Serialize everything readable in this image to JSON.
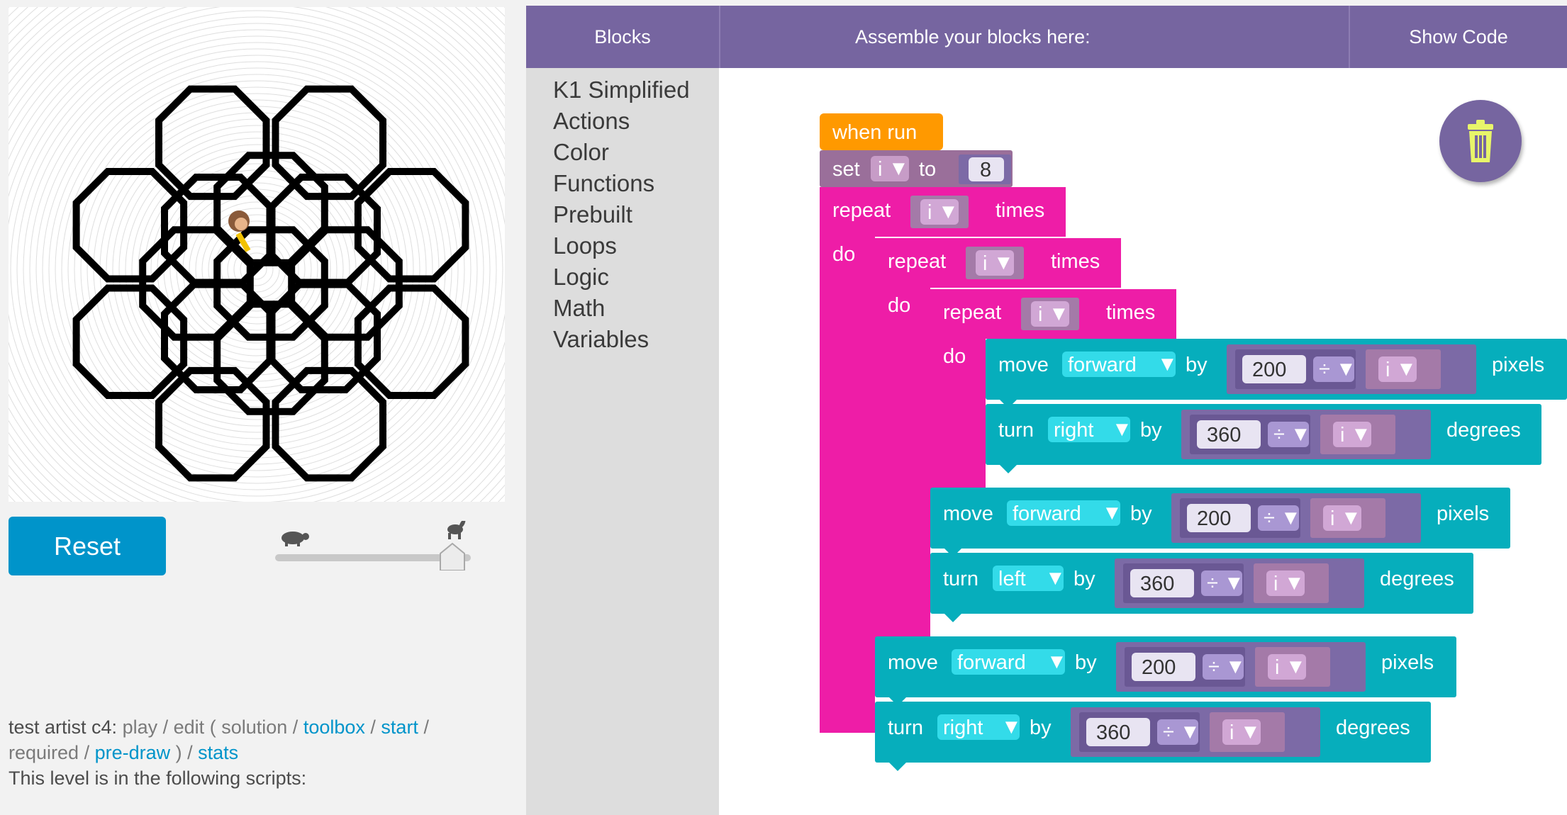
{
  "header": {
    "blocks_label": "Blocks",
    "workspace_label": "Assemble your blocks here:",
    "show_code_label": "Show Code"
  },
  "toolbox": {
    "categories": [
      "K1 Simplified",
      "Actions",
      "Color",
      "Functions",
      "Prebuilt",
      "Loops",
      "Logic",
      "Math",
      "Variables"
    ]
  },
  "controls": {
    "reset_label": "Reset",
    "speed_slider_value": 1.0
  },
  "level_info": {
    "name": "test artist c4:",
    "play": "play",
    "edit": "edit",
    "solution": "solution",
    "toolbox": "toolbox",
    "start": "start",
    "required": "required",
    "predraw": "pre-draw",
    "stats": "stats",
    "scripts_text": "This level is in the following scripts:"
  },
  "program": {
    "when_run": "when run",
    "set": "set",
    "variable": "i",
    "to": "to",
    "initial_value": "8",
    "repeat": "repeat",
    "times": "times",
    "do": "do",
    "move": "move",
    "turn": "turn",
    "by": "by",
    "pixels": "pixels",
    "degrees": "degrees",
    "forward": "forward",
    "right": "right",
    "left": "left",
    "divide": "÷",
    "distance": "200",
    "angle": "360",
    "dropdown_arrow": "▼"
  },
  "colors": {
    "header": "#7665a0",
    "event_block": "#ff9900",
    "variable_block": "#9a6f9a",
    "loop_block": "#ee1da7",
    "action_block": "#06aebc",
    "math_block": "#7c6aa6",
    "reset_button": "#0094ca"
  },
  "icons": {
    "trash": "trash-icon",
    "turtle": "turtle-icon",
    "rabbit": "rabbit-icon",
    "artist": "artist-avatar"
  }
}
